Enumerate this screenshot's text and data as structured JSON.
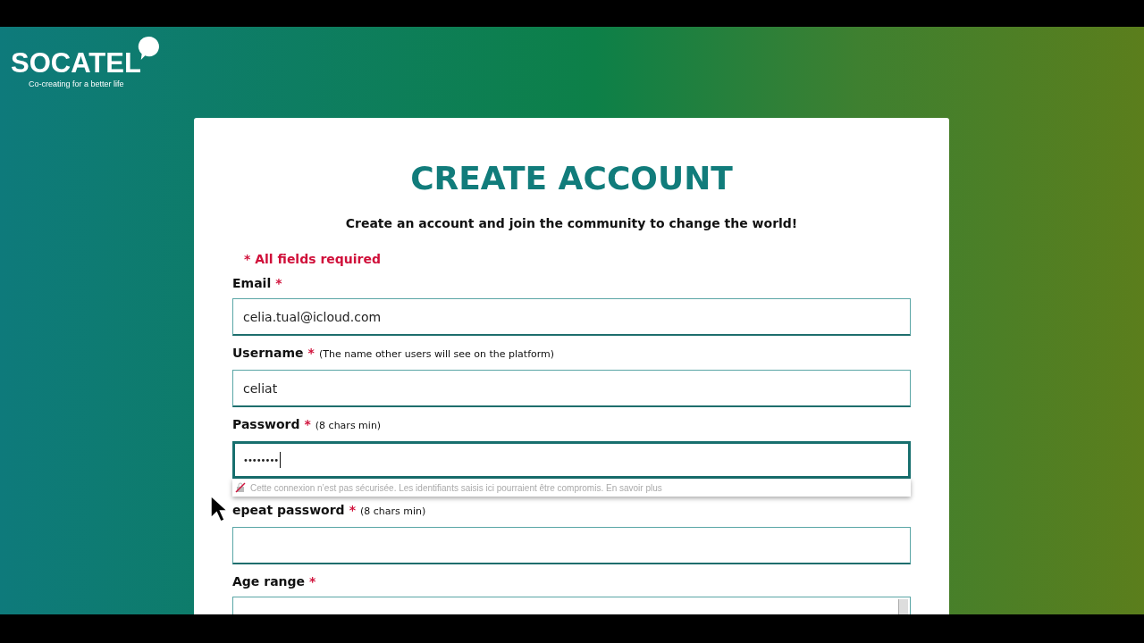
{
  "logo": {
    "name": "SOCATEL",
    "tagline": "Co-creating for a better life"
  },
  "form": {
    "title": "CREATE ACCOUNT",
    "subtitle": "Create an account and join the community to change the world!",
    "required_note": "* All fields required",
    "fields": [
      {
        "kind": "text",
        "label": "Email",
        "star": "*",
        "value": "celia.tual@icloud.com",
        "focused": false
      },
      {
        "kind": "text",
        "label": "Username",
        "star": "*",
        "note": "(The name other users will see on the platform)",
        "value": "celiat",
        "focused": false
      },
      {
        "kind": "password",
        "label": "Password",
        "star": "*",
        "note": "(8 chars min)",
        "value": "••••••••",
        "focused": true
      },
      {
        "kind": "password",
        "label": "epeat password",
        "star": "*",
        "note": "(8 chars min)",
        "focused": false
      },
      {
        "kind": "select",
        "label": "Age range",
        "star": "*",
        "focused": false
      }
    ]
  },
  "autofill_warning": {
    "text": "Cette connexion n’est pas sécurisée. Les identifiants saisis ici pourraient être compromis. En savoir plus"
  }
}
